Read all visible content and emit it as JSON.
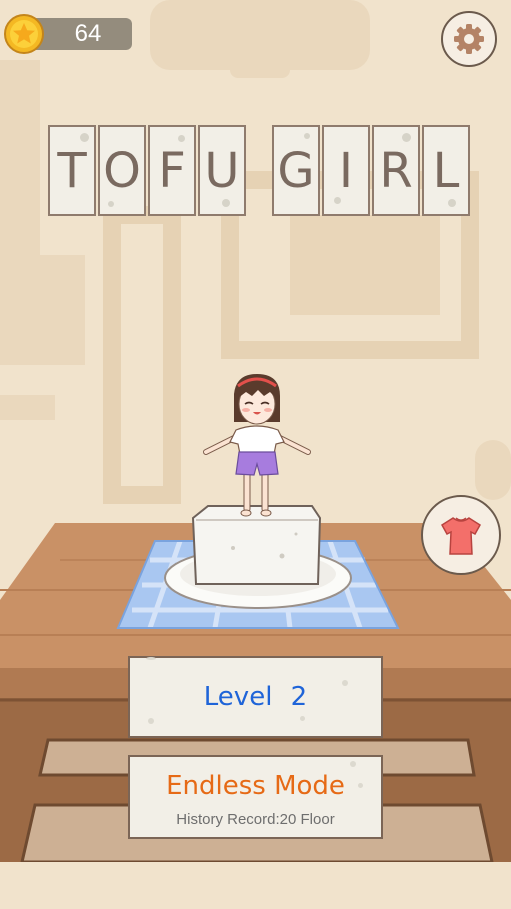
{
  "hud": {
    "coins": "64",
    "coin_icon": "star-coin-icon",
    "settings_icon": "gear-icon"
  },
  "title": {
    "word1": [
      "T",
      "O",
      "F",
      "U"
    ],
    "word2": [
      "G",
      "I",
      "R",
      "L"
    ]
  },
  "outfit_icon": "shirt-icon",
  "menu": {
    "level_label": "Level  2",
    "endless_label": "Endless Mode",
    "record_label": "History Record:20 Floor"
  },
  "colors": {
    "background": "#f1e3cc",
    "level_text": "#1f64d8",
    "endless_text": "#e66a16"
  }
}
